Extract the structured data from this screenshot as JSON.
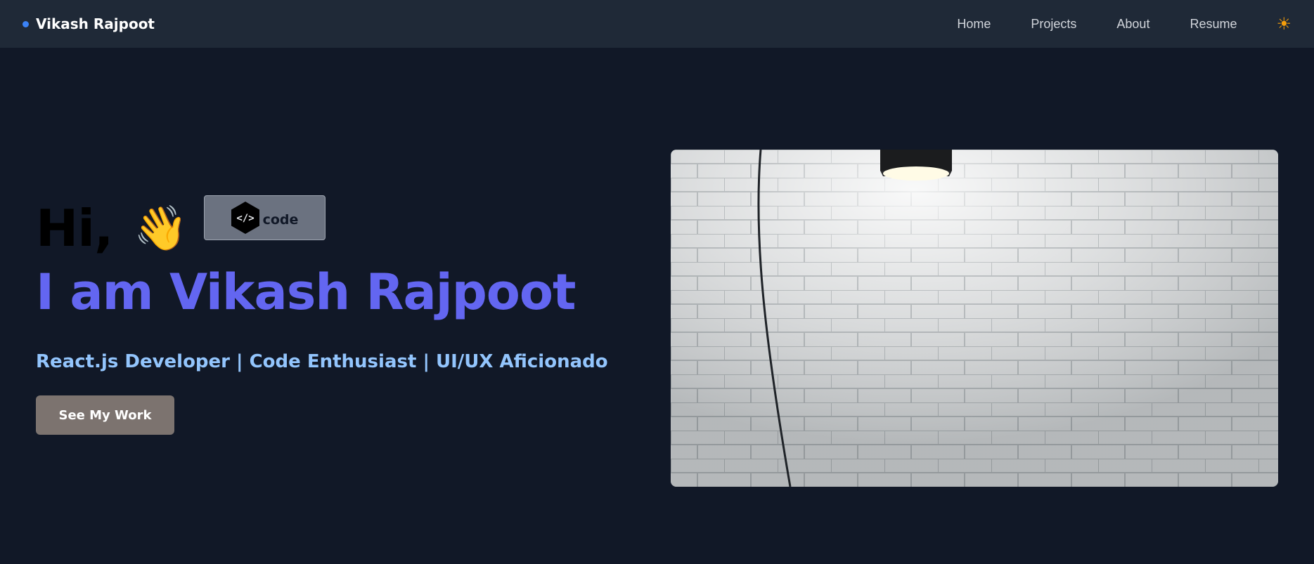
{
  "nav": {
    "brand": "Vikash Rajpoot",
    "links": [
      {
        "label": "Home"
      },
      {
        "label": "Projects"
      },
      {
        "label": "About"
      },
      {
        "label": "Resume"
      }
    ],
    "theme_icon": "sun-icon",
    "theme_glyph": "☀"
  },
  "hero": {
    "greeting": "Hi,",
    "wave_emoji": "👋",
    "code_badge": "code",
    "code_glyph": "</>",
    "headline": "I am Vikash Rajpoot",
    "tagline": "React.js Developer | Code Enthusiast | UI/UX Aficionado",
    "cta_label": "See My Work"
  },
  "colors": {
    "background": "#111827",
    "navbar": "#1f2937",
    "accent": "#6366f1",
    "tagline": "#93c5fd",
    "brand_dot": "#3b82f6",
    "sun": "#f59e0b"
  }
}
